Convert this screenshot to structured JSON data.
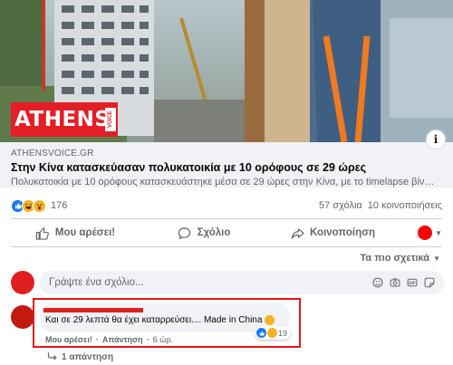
{
  "preview": {
    "logo_text": "ATHENS",
    "logo_sub": "VOICE",
    "domain": "ATHENSVOICE.GR",
    "title": "Στην Κίνα κατασκεύασαν πολυκατοικία με 10 ορόφους σε 29 ώρες",
    "description": "Πολυκατοικία με 10 ορόφους κατασκευάστηκε μέσα σε 29 ώρες στην Κίνα, με το timelapse βίντεο ...",
    "info_label": "i"
  },
  "reactions": {
    "icons": [
      "like-icon",
      "haha-icon",
      "wow-icon"
    ],
    "count": "176",
    "comments": "57 σχόλια",
    "shares": "10 κοινοποιήσεις"
  },
  "actions": {
    "like": "Μου αρέσει!",
    "comment": "Σχόλιο",
    "share": "Κοινοποίηση"
  },
  "sort_label": "Τα πιο σχετικά",
  "comment_input": {
    "placeholder": "Γράψτε ένα σχόλιο...",
    "icons": [
      "emoji-icon",
      "camera-icon",
      "gif-icon",
      "sticker-icon"
    ]
  },
  "comment": {
    "text": "Και σε 29 λεπτά θα έχει καταρρεύσει.... Made in China",
    "like_action": "Μου αρέσει!",
    "reply_action": "Απάντηση",
    "time": "6 ώρ.",
    "reaction_count": "19",
    "replies": "1 απάντηση"
  },
  "colors": {
    "accent": "#1877f2",
    "highlight": "#e4141b",
    "logo": "#e41e26",
    "muted": "#65676b"
  }
}
